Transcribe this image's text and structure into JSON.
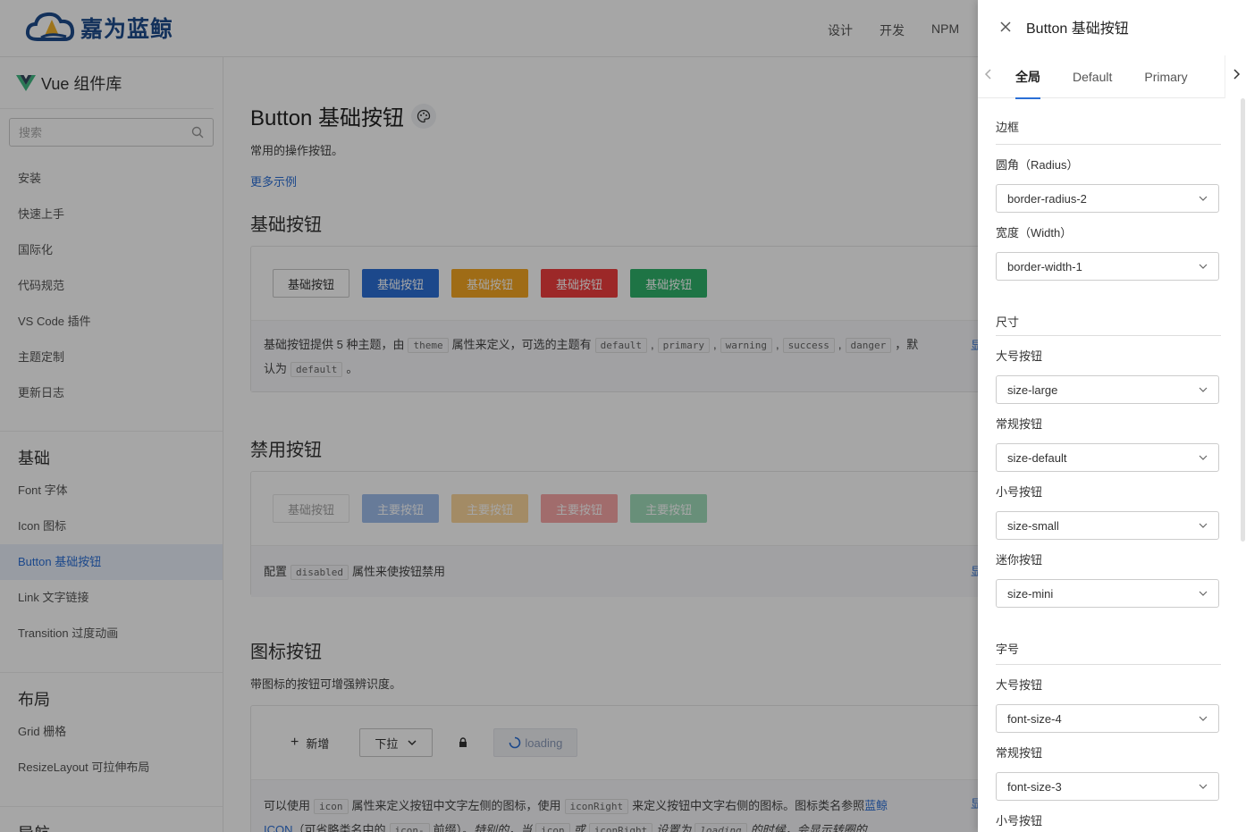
{
  "header": {
    "logo_text": "嘉为蓝鲸",
    "nav": [
      "设计",
      "开发",
      "NPM"
    ]
  },
  "sidebar": {
    "title": "Vue 组件库",
    "search_placeholder": "搜索",
    "items": [
      "安装",
      "快速上手",
      "国际化",
      "代码规范",
      "VS Code 插件",
      "主题定制",
      "更新日志"
    ],
    "groups": [
      {
        "title": "基础",
        "items": [
          "Font 字体",
          "Icon 图标",
          "Button 基础按钮",
          "Link 文字链接",
          "Transition 过度动画"
        ],
        "active": "Button 基础按钮"
      },
      {
        "title": "布局",
        "items": [
          "Grid 栅格",
          "ResizeLayout 可拉伸布局"
        ]
      },
      {
        "title": "导航"
      }
    ]
  },
  "main": {
    "title": "Button 基础按钮",
    "description": "常用的操作按钮。",
    "more_link": "更多示例",
    "sections": [
      {
        "title": "基础按钮",
        "buttons": [
          "基础按钮",
          "基础按钮",
          "基础按钮",
          "基础按钮",
          "基础按钮"
        ],
        "desc_parts": [
          "基础按钮提供 5 种主题，由",
          "theme",
          "属性来定义，可选的主题有",
          "default",
          "primary",
          "warning",
          "success",
          "danger",
          "，默",
          "认为",
          "default",
          "。",
          "显"
        ]
      },
      {
        "title": "禁用按钮",
        "buttons": [
          "基础按钮",
          "主要按钮",
          "主要按钮",
          "主要按钮",
          "主要按钮"
        ],
        "desc_parts": [
          "配置",
          "disabled",
          "属性来使按钮禁用",
          "显"
        ]
      },
      {
        "title": "图标按钮",
        "subtitle": "带图标的按钮可增强辨识度。",
        "buttons": [
          "新增",
          "下拉",
          "loading"
        ],
        "desc_parts": [
          "可以使用",
          "icon",
          "属性来定义按钮中文字左侧的图标，使用",
          "iconRight",
          "来定义按钮中文字右侧的图标。图标类名参照",
          "蓝鲸",
          "ICON",
          "（可省略类名中的",
          "icon-",
          "前缀）。",
          "特别的，当",
          "icon",
          "或",
          "iconRight",
          "设置为",
          "loading",
          "的时候，会显示转圈的",
          "显"
        ]
      }
    ]
  },
  "drawer": {
    "title": "Button 基础按钮",
    "tabs": [
      "全局",
      "Default",
      "Primary"
    ],
    "active_tab": "全局",
    "sections": [
      {
        "title": "边框",
        "fields": [
          {
            "label": "圆角（Radius）",
            "value": "border-radius-2"
          },
          {
            "label": "宽度（Width）",
            "value": "border-width-1"
          }
        ]
      },
      {
        "title": "尺寸",
        "fields": [
          {
            "label": "大号按钮",
            "value": "size-large"
          },
          {
            "label": "常规按钮",
            "value": "size-default"
          },
          {
            "label": "小号按钮",
            "value": "size-small"
          },
          {
            "label": "迷你按钮",
            "value": "size-mini"
          }
        ]
      },
      {
        "title": "字号",
        "fields": [
          {
            "label": "大号按钮",
            "value": "font-size-4"
          },
          {
            "label": "常规按钮",
            "value": "font-size-3"
          },
          {
            "label": "小号按钮",
            "value": ""
          }
        ]
      }
    ]
  },
  "colors": {
    "primary": "#2b6fd6",
    "warning": "#f5a623",
    "danger": "#f03e3e",
    "success": "#2fb36a"
  }
}
